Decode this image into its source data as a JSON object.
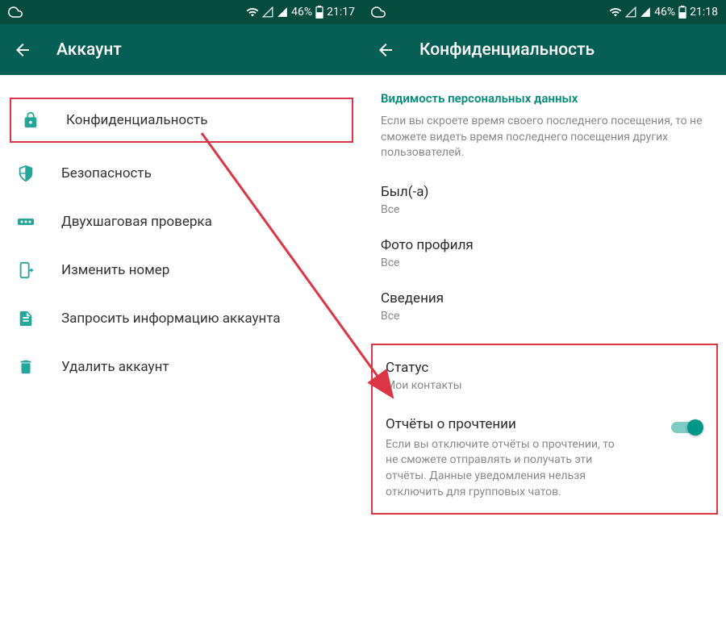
{
  "left": {
    "status": {
      "battery_text": "46%",
      "time": "21:17"
    },
    "header": {
      "title": "Аккаунт"
    },
    "menu": {
      "privacy": "Конфиденциальность",
      "security": "Безопасность",
      "two_step": "Двухшаговая проверка",
      "change_number": "Изменить номер",
      "request_info": "Запросить информацию аккаунта",
      "delete_account": "Удалить аккаунт"
    }
  },
  "right": {
    "status": {
      "battery_text": "46%",
      "time": "21:18"
    },
    "header": {
      "title": "Конфиденциальность"
    },
    "section": {
      "title": "Видимость персональных данных",
      "description": "Если вы скроете время своего последнего посещения, то не сможете видеть время последнего посещения других пользователей."
    },
    "items": {
      "last_seen": {
        "title": "Был(-а)",
        "value": "Все"
      },
      "photo": {
        "title": "Фото профиля",
        "value": "Все"
      },
      "about": {
        "title": "Сведения",
        "value": "Все"
      },
      "status": {
        "title": "Статус",
        "value": "Мои контакты"
      },
      "read_receipts": {
        "title": "Отчёты о прочтении",
        "description": "Если вы отключите отчёты о прочтении, то не сможете отправлять и получать эти отчёты. Данные уведомления нельзя отключить для групповых чатов."
      }
    }
  }
}
